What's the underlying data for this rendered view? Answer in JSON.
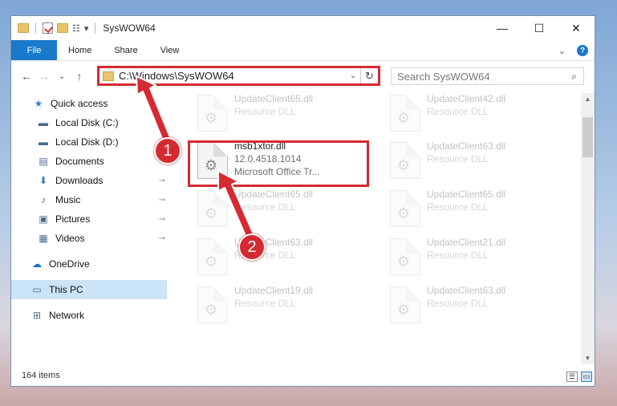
{
  "window": {
    "title": "SysWOW64",
    "minimize": "—",
    "maximize": "☐",
    "close": "✕"
  },
  "quick_access_toolbar": {
    "dropdown": "▾"
  },
  "ribbon": {
    "tabs": [
      "File",
      "Home",
      "Share",
      "View"
    ],
    "collapse": "⌄",
    "help": "?"
  },
  "nav": {
    "back": "←",
    "forward": "→",
    "recent": "⌄",
    "up": "↑"
  },
  "address": {
    "path": "C:\\Windows\\SysWOW64",
    "dropdown": "⌄",
    "refresh": "↻"
  },
  "search": {
    "placeholder": "Search SysWOW64",
    "icon": "⌕"
  },
  "sidebar": {
    "items": [
      {
        "label": "Quick access",
        "icon": "★",
        "pinned": false
      },
      {
        "label": "Local Disk (C:)",
        "icon": "▬",
        "pinned": false
      },
      {
        "label": "Local Disk (D:)",
        "icon": "▬",
        "pinned": false
      },
      {
        "label": "Documents",
        "icon": "▤",
        "pinned": true
      },
      {
        "label": "Downloads",
        "icon": "⬇",
        "pinned": true
      },
      {
        "label": "Music",
        "icon": "♪",
        "pinned": true
      },
      {
        "label": "Pictures",
        "icon": "▣",
        "pinned": true
      },
      {
        "label": "Videos",
        "icon": "▦",
        "pinned": true
      },
      {
        "label": "OneDrive",
        "icon": "☁",
        "pinned": false
      },
      {
        "label": "This PC",
        "icon": "▭",
        "pinned": false
      },
      {
        "label": "Network",
        "icon": "⊞",
        "pinned": false
      }
    ],
    "pin_glyph": "📌"
  },
  "files": [
    {
      "name": "UpdateClient65.dll",
      "sub": "Resource DLL",
      "ghost": true
    },
    {
      "name": "UpdateClient42.dll",
      "sub": "Resource DLL",
      "ghost": true
    },
    {
      "name": "msb1xtor.dll",
      "version": "12.0.4518.1014",
      "sub": "Microsoft Office Tr...",
      "ghost": false
    },
    {
      "name": "UpdateClient63.dll",
      "sub": "Resource DLL",
      "ghost": true
    },
    {
      "name": "UpdateClient65.dll",
      "sub": "Resource DLL",
      "ghost": true
    },
    {
      "name": "UpdateClient65.dll",
      "sub": "Resource DLL",
      "ghost": true
    },
    {
      "name": "UpdateClient63.dll",
      "sub": "Resource DLL",
      "ghost": true
    },
    {
      "name": "UpdateClient21.dll",
      "sub": "Resource DLL",
      "ghost": true
    },
    {
      "name": "UpdateClient19.dll",
      "sub": "Resource DLL",
      "ghost": true
    },
    {
      "name": "UpdateClient63.dll",
      "sub": "Resource DLL",
      "ghost": true
    }
  ],
  "status": {
    "count": "164 items"
  },
  "annotations": {
    "badge1": "1",
    "badge2": "2"
  },
  "colors": {
    "accent": "#1979ca",
    "annotation": "#d62a33",
    "selection": "#cce4f7"
  }
}
